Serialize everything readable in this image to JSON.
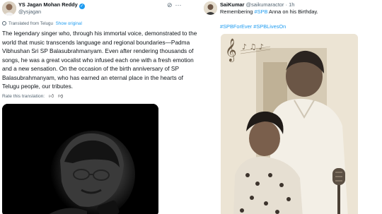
{
  "left_post": {
    "display_name": "YS Jagan Mohan Reddy",
    "handle": "@ysjagan",
    "translated_from": "Translated from Telugu",
    "show_original": "Show original",
    "text": "The legendary singer who, through his immortal voice, demonstrated to the world that music transcends language and regional boundaries—Padma Vibhushan Sri SP Balasubrahmanyam. Even after rendering thousands of songs, he was a great vocalist who infused each one with a fresh emotion and a new sensation. On the occasion of the birth anniversary of SP Balasubrahmanyam, who has earned an eternal place in the hearts of Telugu people, our tributes.",
    "rate_translation": "Rate this translation:",
    "photo_alt": "black and white photo of SP Balasubrahmanyam singing into a microphone"
  },
  "right_post": {
    "display_name": "SaiKumar",
    "handle": "@saikumaractor",
    "time": "1h",
    "text_prefix": "Remembering ",
    "text_hashtag": "#SPB",
    "text_suffix": " Anna on his Birthday.",
    "hashtags": "#SPBForEver #SPBLivesOn",
    "photo_alt": "vintage sepia photo of SP Balasubrahmanyam with Sai Kumar"
  },
  "icons": {
    "verified": "verified-badge-icon",
    "grok": "grok-icon",
    "more": "more-icon",
    "globe": "globe-icon",
    "thumbs_up": "thumbs-up-icon",
    "thumbs_down": "thumbs-down-icon"
  },
  "colors": {
    "accent": "#1d9bf0",
    "text": "#0f1419",
    "muted": "#536471"
  }
}
